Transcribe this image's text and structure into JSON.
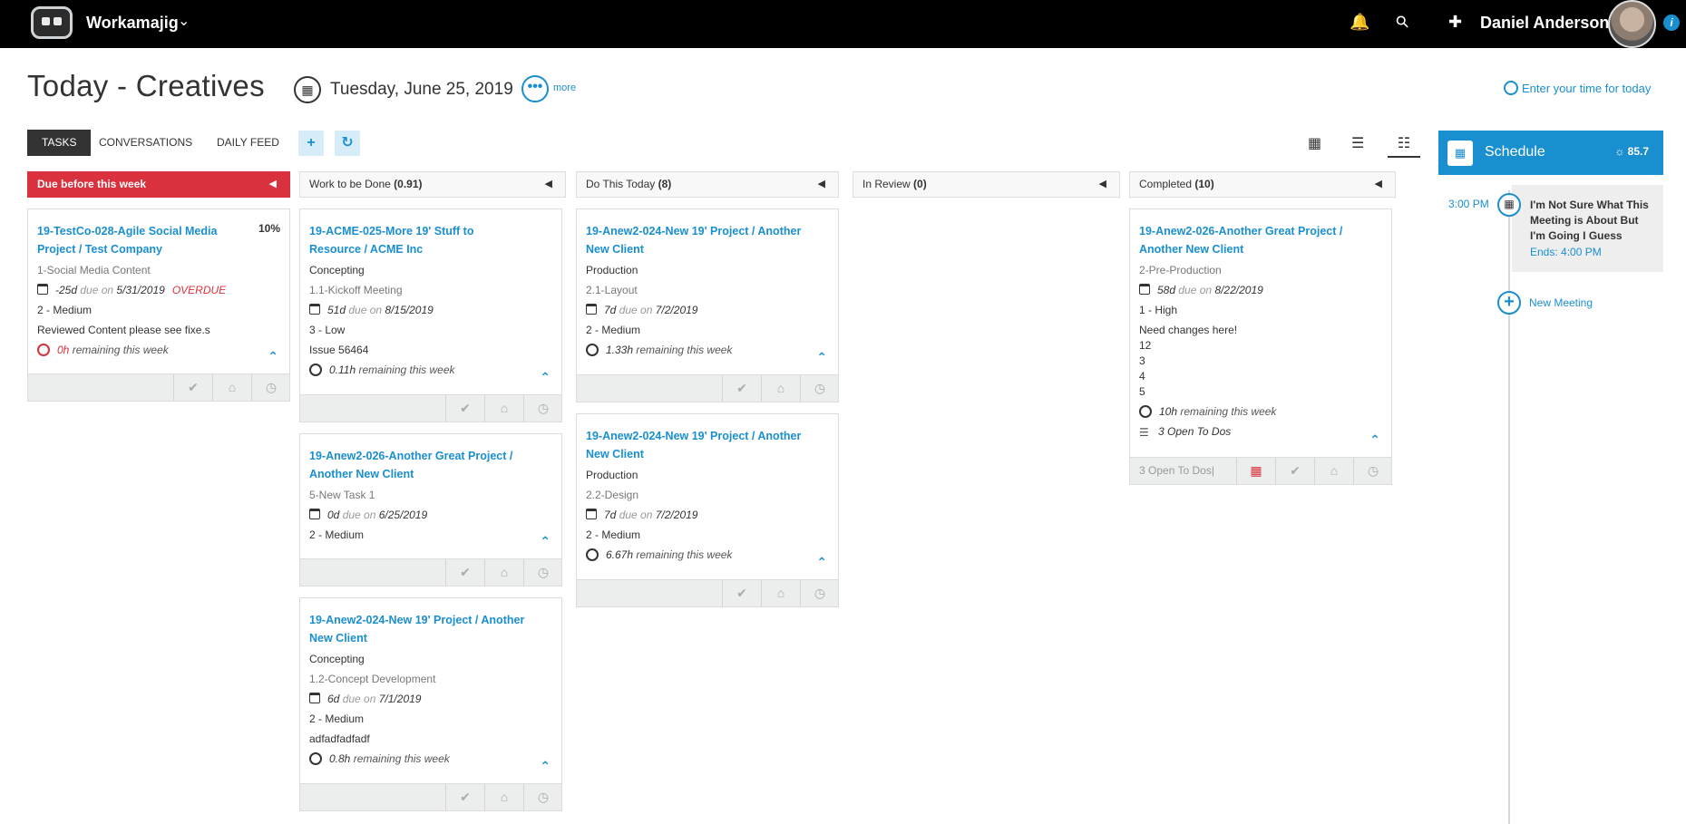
{
  "topbar": {
    "app_name": "Workamajig",
    "app_chevron": "⌄",
    "user_name": "Daniel Anderson",
    "bell_glyph": "🔔",
    "search_glyph": "⚲",
    "plus_glyph": "✚",
    "info_glyph": "i"
  },
  "header": {
    "title": "Today - Creatives",
    "date": "Tuesday, June 25, 2019",
    "calendar_glyph": "▦",
    "more_glyph": "•••",
    "more_label": "more",
    "enter_time_label": "Enter your time for today"
  },
  "tabs": {
    "tasks": "TASKS",
    "conversations": "CONVERSATIONS",
    "daily_feed": "DAILY FEED",
    "add_glyph": "+",
    "refresh_glyph": "↻"
  },
  "views": {
    "grid": "▦",
    "list": "☰",
    "detail": "☷"
  },
  "columns": [
    {
      "label": "Due before this week",
      "count": ""
    },
    {
      "label": "Work to be Done",
      "count": "(0.91)"
    },
    {
      "label": "Do This Today",
      "count": "(8)"
    },
    {
      "label": "In Review",
      "count": "(0)"
    },
    {
      "label": "Completed",
      "count": "(10)"
    }
  ],
  "collapse_arrow": "◀",
  "footer_icons": {
    "check": "✔",
    "msg": "⌂",
    "clock": "◷",
    "cal": "▦",
    "chev_up": "⌃"
  },
  "cards": {
    "c1": {
      "title": "19-TestCo-028-Agile Social Media Project / Test Company",
      "pct": "10%",
      "task": "1-Social Media Content",
      "days": "-25d",
      "due_label": "due on",
      "due_date": "5/31/2019",
      "overdue": "OVERDUE",
      "priority": "2 - Medium",
      "note": "Reviewed Content please see fixe.s",
      "hours": "0h",
      "remaining": "remaining this week"
    },
    "c2": {
      "title": "19-ACME-025-More 19' Stuff to Resource / ACME Inc",
      "phase": "Concepting",
      "task": "1.1-Kickoff Meeting",
      "days": "51d",
      "due_label": "due on",
      "due_date": "8/15/2019",
      "priority": "3 - Low",
      "note": "Issue 56464",
      "hours": "0.11h",
      "remaining": "remaining this week"
    },
    "c3": {
      "title": "19-Anew2-026-Another Great Project / Another New Client",
      "task": "5-New Task 1",
      "days": "0d",
      "due_label": "due on",
      "due_date": "6/25/2019",
      "priority": "2 - Medium"
    },
    "c4": {
      "title": "19-Anew2-024-New 19' Project / Another New Client",
      "phase": "Concepting",
      "task": "1.2-Concept Development",
      "days": "6d",
      "due_label": "due on",
      "due_date": "7/1/2019",
      "priority": "2 - Medium",
      "note": "adfadfadfadf",
      "hours": "0.8h",
      "remaining": "remaining this week"
    },
    "c5": {
      "title": "19-Anew2-024-New 19' Project / Another New Client",
      "phase": "Production",
      "task": "2.1-Layout",
      "days": "7d",
      "due_label": "due on",
      "due_date": "7/2/2019",
      "priority": "2 - Medium",
      "hours": "1.33h",
      "remaining": "remaining this week"
    },
    "c6": {
      "title": "19-Anew2-024-New 19' Project / Another New Client",
      "phase": "Production",
      "task": "2.2-Design",
      "days": "7d",
      "due_label": "due on",
      "due_date": "7/2/2019",
      "priority": "2 - Medium",
      "hours": "6.67h",
      "remaining": "remaining this week"
    },
    "c7": {
      "title": "19-Anew2-026-Another Great Project / Another New Client",
      "task": "2-Pre-Production",
      "days": "58d",
      "due_label": "due on",
      "due_date": "8/22/2019",
      "priority": "1 - High",
      "notes": [
        "Need changes here!",
        "12",
        "3",
        "4",
        "5"
      ],
      "hours": "10h",
      "remaining": "remaining this week",
      "open_todos": "3 Open To Dos",
      "footer_todos": "3 Open To Dos|"
    }
  },
  "schedule": {
    "title": "Schedule",
    "icon_glyph": "▦",
    "temp": "☼ 85.7",
    "time": "3:00 PM",
    "meeting_title": "I'm Not Sure What This Meeting is About But I'm Going I Guess",
    "meeting_ends": "Ends: 4:00 PM",
    "new_meeting": "New Meeting",
    "new_glyph": "+"
  }
}
